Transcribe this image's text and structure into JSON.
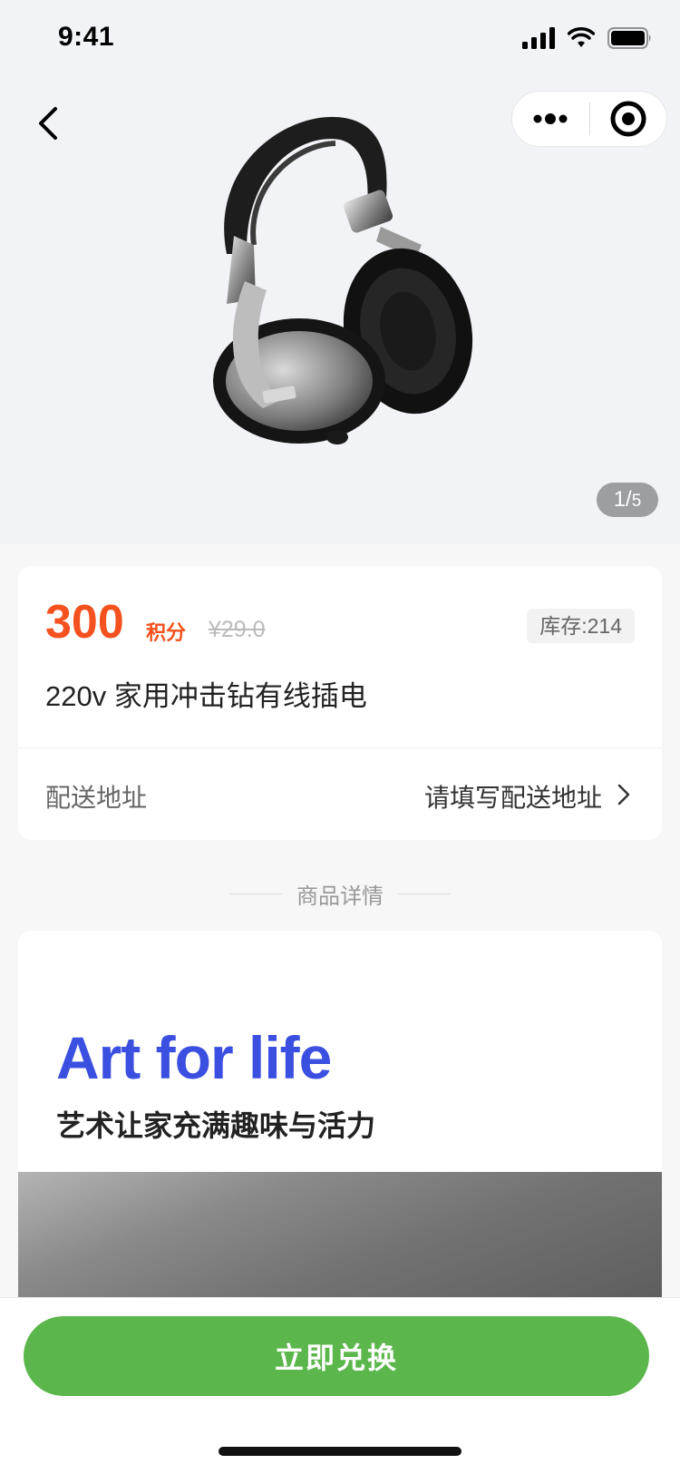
{
  "status_bar": {
    "time": "9:41"
  },
  "gallery": {
    "current": "1",
    "total": "5"
  },
  "product": {
    "price": "300",
    "price_unit": "积分",
    "original_price": "¥29.0",
    "stock": "库存:214",
    "title": "220v 家用冲击钻有线插电"
  },
  "delivery": {
    "label": "配送地址",
    "placeholder": "请填写配送地址"
  },
  "detail": {
    "section_title": "商品详情",
    "headline_en": "Art for life",
    "headline_cn": "艺术让家充满趣味与活力"
  },
  "action": {
    "exchange_label": "立即兑换"
  },
  "colors": {
    "accent_orange": "#f4511e",
    "button_green": "#5bb64b",
    "headline_blue": "#3b4fe0"
  }
}
